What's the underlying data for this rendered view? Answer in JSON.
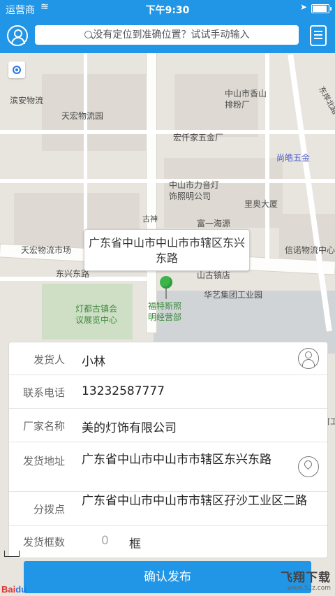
{
  "status_bar": {
    "carrier": "运营商",
    "time": "下午9:30"
  },
  "top_bar": {
    "search_placeholder": "没有定位到准确位置？试试手动输入"
  },
  "map": {
    "pois": [
      "滨安物流",
      "天宏物流园",
      "中山市香山排粉厂",
      "宏仟家五金厂",
      "尚皓五金",
      "中山市力音灯饰照明公司",
      "里奥大厦",
      "天宏物流市场",
      "富一海源",
      "信诺物流中心",
      "山古镇店",
      "东兴东路",
      "华艺集团工业园",
      "灯都古镇会议展览中心",
      "福特斯照明经营部",
      "东岸北路",
      "古神",
      "可工"
    ],
    "callout": "广东省中山市中山市市辖区东兴东路",
    "brand_logo": "Baidu地图"
  },
  "form": {
    "shipper": {
      "label": "发货人",
      "value": "小林"
    },
    "phone": {
      "label": "联系电话",
      "value": "13232587777"
    },
    "factory": {
      "label": "厂家名称",
      "value": "美的灯饰有限公司"
    },
    "address": {
      "label": "发货地址",
      "value": "广东省中山市中山市市辖区东兴东路"
    },
    "branch": {
      "label": "分拨点",
      "value": "广东省中山市中山市市辖区孖沙工业区二路"
    },
    "boxes": {
      "label": "发货框数",
      "value": "0",
      "unit": "框"
    }
  },
  "submit_label": "确认发布",
  "watermark": {
    "title": "飞翔下载",
    "url": "www.52z.com"
  },
  "colors": {
    "primary": "#2196e6",
    "pin": "#3bb54a"
  }
}
